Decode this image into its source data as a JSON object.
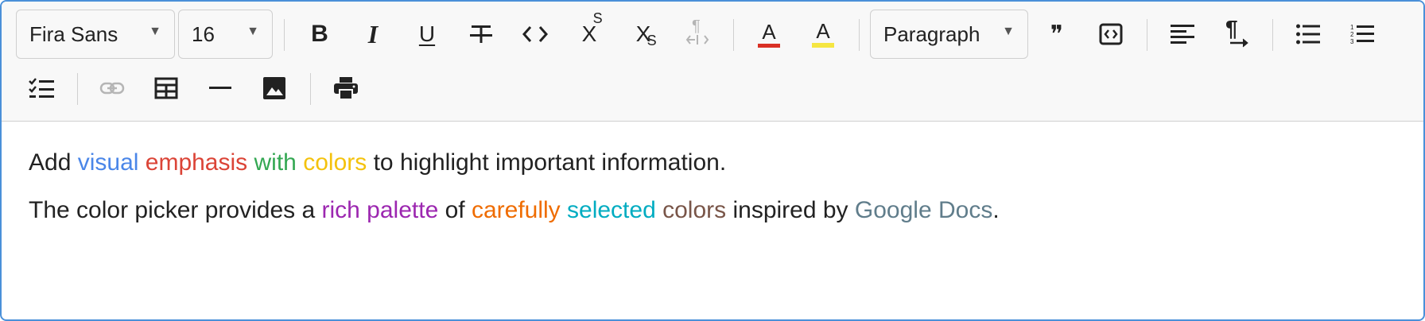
{
  "toolbar": {
    "font_family": {
      "value": "Fira Sans",
      "caret": "▼"
    },
    "font_size": {
      "value": "16",
      "caret": "▼"
    },
    "block_format": {
      "value": "Paragraph",
      "caret": "▼"
    },
    "buttons": [
      {
        "icon": "bold-icon"
      },
      {
        "icon": "italic-icon"
      },
      {
        "icon": "underline-icon"
      },
      {
        "icon": "strikethrough-icon"
      },
      {
        "icon": "code-icon"
      },
      {
        "icon": "superscript-icon"
      },
      {
        "icon": "subscript-icon"
      },
      {
        "icon": "clear-format-icon",
        "disabled": true
      },
      {
        "icon": "text-color-icon",
        "color": "#d93025"
      },
      {
        "icon": "highlight-color-icon",
        "color": "#f5e642"
      },
      {
        "icon": "blockquote-icon"
      },
      {
        "icon": "code-block-icon"
      },
      {
        "icon": "align-left-icon"
      },
      {
        "icon": "text-direction-icon"
      },
      {
        "icon": "bullet-list-icon"
      },
      {
        "icon": "numbered-list-icon"
      },
      {
        "icon": "task-list-icon"
      },
      {
        "icon": "link-icon",
        "disabled": true
      },
      {
        "icon": "table-icon"
      },
      {
        "icon": "horizontal-rule-icon"
      },
      {
        "icon": "image-icon"
      },
      {
        "icon": "print-icon"
      }
    ],
    "glyphs": {
      "bold": "B",
      "italic": "I",
      "underline": "U",
      "superscript_base": "X",
      "superscript_mark": "S",
      "subscript_base": "X",
      "subscript_mark": "S",
      "pilcrow": "¶",
      "text_color_letter": "A",
      "highlight_letter": "A",
      "quote": "❞"
    }
  },
  "content": {
    "paragraph1": [
      {
        "text": "Add ",
        "color": "#222222"
      },
      {
        "text": "visual",
        "color": "#4a86e8"
      },
      {
        "text": " ",
        "color": "#222222"
      },
      {
        "text": "emphasis",
        "color": "#db4437"
      },
      {
        "text": " ",
        "color": "#222222"
      },
      {
        "text": "with",
        "color": "#34a853"
      },
      {
        "text": " ",
        "color": "#222222"
      },
      {
        "text": "colors",
        "color": "#f4c20d"
      },
      {
        "text": " to highlight important information.",
        "color": "#222222"
      }
    ],
    "paragraph2": [
      {
        "text": "The color picker provides a ",
        "color": "#222222"
      },
      {
        "text": "rich palette",
        "color": "#9c27b0"
      },
      {
        "text": " of ",
        "color": "#222222"
      },
      {
        "text": "carefully",
        "color": "#ef6c00"
      },
      {
        "text": " ",
        "color": "#222222"
      },
      {
        "text": "selected",
        "color": "#00acc1"
      },
      {
        "text": " ",
        "color": "#222222"
      },
      {
        "text": "colors",
        "color": "#795548"
      },
      {
        "text": " inspired by ",
        "color": "#222222"
      },
      {
        "text": "Google Docs",
        "color": "#607d8b"
      },
      {
        "text": ".",
        "color": "#222222"
      }
    ]
  }
}
